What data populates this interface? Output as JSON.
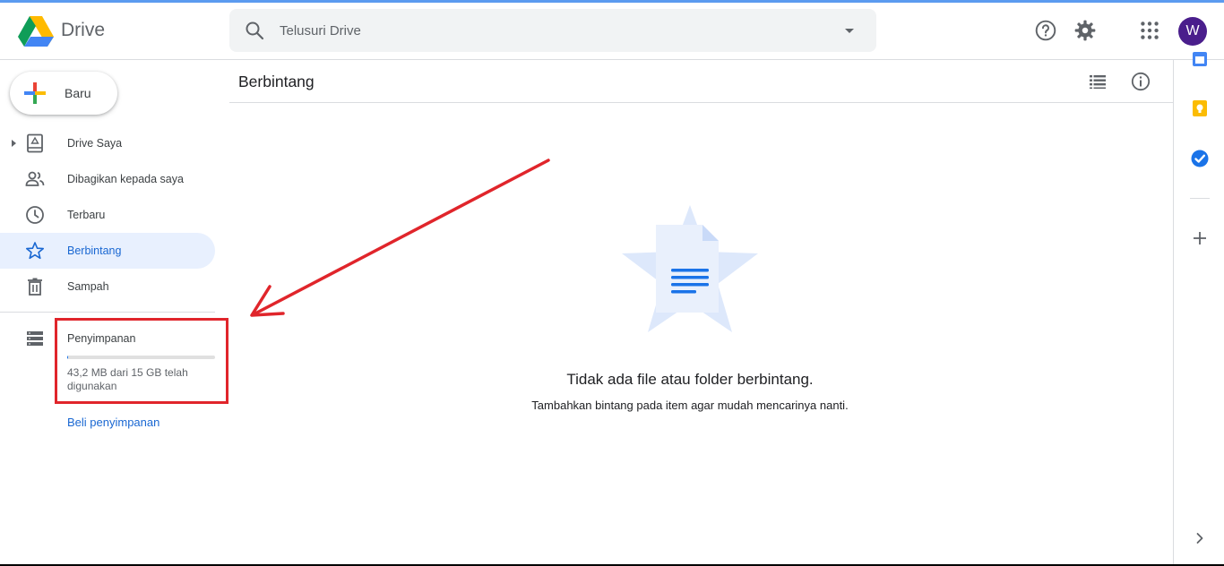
{
  "app": {
    "name": "Drive"
  },
  "search": {
    "placeholder": "Telusuri Drive"
  },
  "account": {
    "initial": "W",
    "color": "#4a1e8c"
  },
  "sidebar": {
    "new_label": "Baru",
    "items": [
      {
        "label": "Drive Saya",
        "icon": "my-drive-icon"
      },
      {
        "label": "Dibagikan kepada saya",
        "icon": "shared-people-icon"
      },
      {
        "label": "Terbaru",
        "icon": "clock-icon"
      },
      {
        "label": "Berbintang",
        "icon": "star-icon",
        "active": true
      },
      {
        "label": "Sampah",
        "icon": "trash-icon"
      }
    ],
    "storage": {
      "title": "Penyimpanan",
      "usage": "43,2 MB dari 15 GB telah digunakan",
      "used_fraction": 0.003,
      "buy_label": "Beli penyimpanan"
    }
  },
  "main": {
    "title": "Berbintang",
    "empty_title": "Tidak ada file atau folder berbintang.",
    "empty_subtitle": "Tambahkan bintang pada item agar mudah mencarinya nanti."
  },
  "colors": {
    "accent": "#1a73e8",
    "active_bg": "#e8f0fe",
    "annotation_red": "#e0252b"
  }
}
